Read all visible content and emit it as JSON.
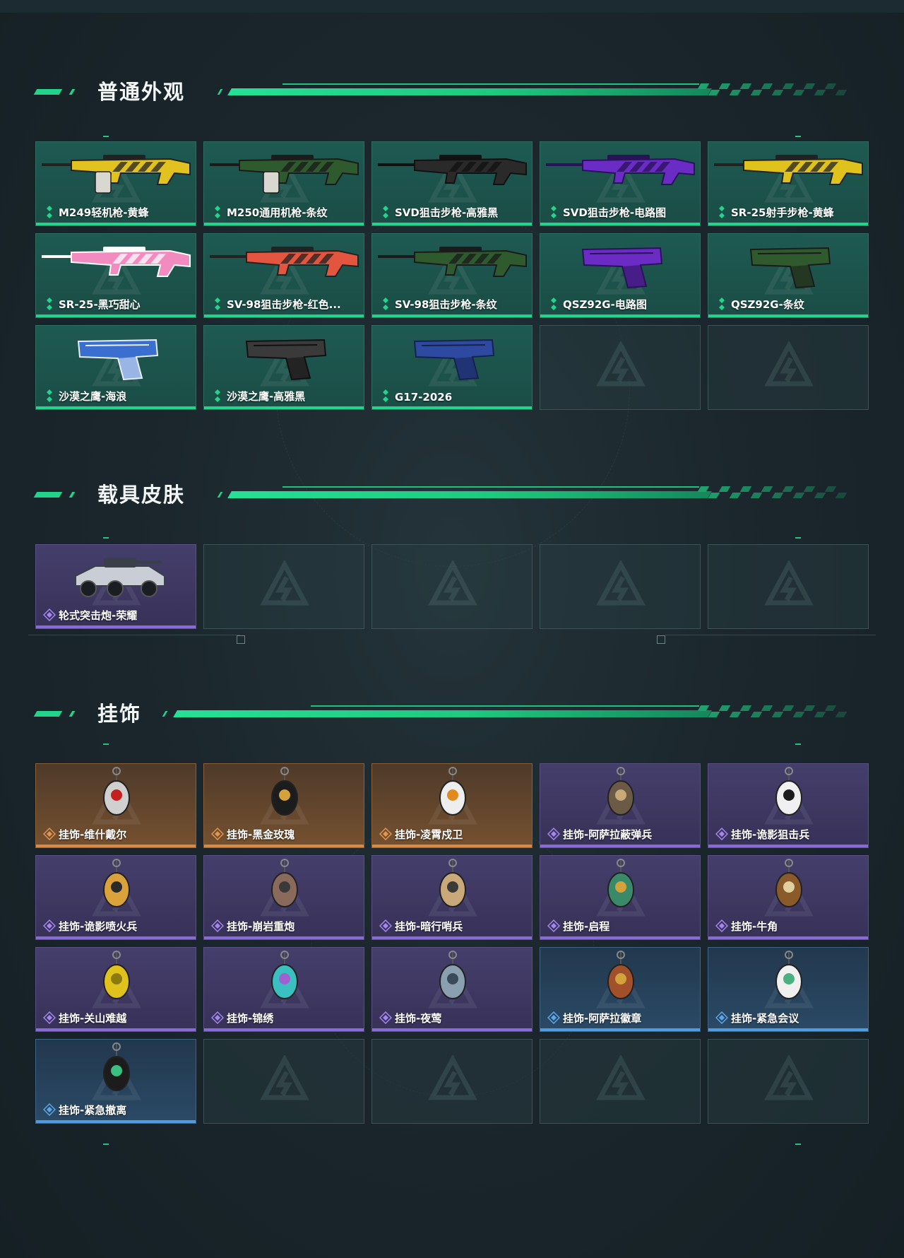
{
  "sections": {
    "normal": {
      "title": "普通外观",
      "items": [
        {
          "label": "M249轻机枪-黄蜂",
          "rarity": "green",
          "icon": "machine-gun-icon",
          "colors": [
            "#e2c21e",
            "#222222"
          ]
        },
        {
          "label": "M250通用机枪-条纹",
          "rarity": "green",
          "icon": "machine-gun-icon",
          "colors": [
            "#2f5a2e",
            "#1b1b1b"
          ]
        },
        {
          "label": "SVD狙击步枪-高雅黑",
          "rarity": "green",
          "icon": "sniper-rifle-icon",
          "colors": [
            "#2a2a2a",
            "#111111"
          ]
        },
        {
          "label": "SVD狙击步枪-电路图",
          "rarity": "green",
          "icon": "sniper-rifle-icon",
          "colors": [
            "#6a2cc4",
            "#2a1258"
          ]
        },
        {
          "label": "SR-25射手步枪-黄蜂",
          "rarity": "green",
          "icon": "rifle-icon",
          "colors": [
            "#e0c21c",
            "#222222"
          ]
        },
        {
          "label": "SR-25-黑巧甜心",
          "rarity": "green",
          "icon": "rifle-icon",
          "colors": [
            "#f28cc0",
            "#ffffff"
          ]
        },
        {
          "label": "SV-98狙击步枪-红色...",
          "rarity": "green",
          "icon": "sniper-rifle-icon",
          "colors": [
            "#e2553e",
            "#222222"
          ]
        },
        {
          "label": "SV-98狙击步枪-条纹",
          "rarity": "green",
          "icon": "sniper-rifle-icon",
          "colors": [
            "#2f5a2e",
            "#1b1b1b"
          ]
        },
        {
          "label": "QSZ92G-电路图",
          "rarity": "green",
          "icon": "pistol-icon",
          "colors": [
            "#6a2cc4",
            "#2a1258"
          ]
        },
        {
          "label": "QSZ92G-条纹",
          "rarity": "green",
          "icon": "pistol-icon",
          "colors": [
            "#2f5a2e",
            "#1b1b1b"
          ]
        },
        {
          "label": "沙漠之鹰-海浪",
          "rarity": "green",
          "icon": "pistol-icon",
          "colors": [
            "#3a6fd0",
            "#e8eef5"
          ]
        },
        {
          "label": "沙漠之鹰-高雅黑",
          "rarity": "green",
          "icon": "pistol-icon",
          "colors": [
            "#3a3a3a",
            "#111111"
          ]
        },
        {
          "label": "G17-2026",
          "rarity": "green",
          "icon": "pistol-icon",
          "colors": [
            "#2e4aa0",
            "#16224e"
          ]
        }
      ],
      "empty_slots": 2
    },
    "vehicle": {
      "title": "载具皮肤",
      "items": [
        {
          "label": "轮式突击炮-荣耀",
          "rarity": "purple",
          "icon": "armored-vehicle-icon",
          "colors": [
            "#c9ced6",
            "#3a3f48"
          ]
        }
      ],
      "empty_slots": 4
    },
    "charms": {
      "title": "挂饰",
      "items": [
        {
          "label": "挂饰-维什戴尔",
          "rarity": "orange",
          "icon": "charm-icon",
          "colors": [
            "#d0d0d0",
            "#c42020"
          ]
        },
        {
          "label": "挂饰-黑金玫瑰",
          "rarity": "orange",
          "icon": "charm-icon",
          "colors": [
            "#1c1c1c",
            "#d4a23a"
          ]
        },
        {
          "label": "挂饰-凌霄戍卫",
          "rarity": "orange",
          "icon": "charm-icon",
          "colors": [
            "#eeeeee",
            "#e08a20"
          ]
        },
        {
          "label": "挂饰-阿萨拉蔽弹兵",
          "rarity": "purple",
          "icon": "charm-icon",
          "colors": [
            "#6b5a45",
            "#c9a97a"
          ]
        },
        {
          "label": "挂饰-诡影狙击兵",
          "rarity": "purple",
          "icon": "charm-icon",
          "colors": [
            "#f0f0f0",
            "#1c1c1c"
          ]
        },
        {
          "label": "挂饰-诡影喷火兵",
          "rarity": "purple",
          "icon": "charm-icon",
          "colors": [
            "#d9a23a",
            "#2a2a2a"
          ]
        },
        {
          "label": "挂饰-崩岩重炮",
          "rarity": "purple",
          "icon": "charm-icon",
          "colors": [
            "#8a6a5a",
            "#3a3a3a"
          ]
        },
        {
          "label": "挂饰-暗行哨兵",
          "rarity": "purple",
          "icon": "charm-icon",
          "colors": [
            "#c9a97a",
            "#3a3a3a"
          ]
        },
        {
          "label": "挂饰-启程",
          "rarity": "purple",
          "icon": "charm-icon",
          "colors": [
            "#3a8a6a",
            "#d4a23a"
          ]
        },
        {
          "label": "挂饰-牛角",
          "rarity": "purple",
          "icon": "charm-icon",
          "colors": [
            "#8a5a2a",
            "#e0d0a0"
          ]
        },
        {
          "label": "挂饰-关山难越",
          "rarity": "purple",
          "icon": "charm-icon",
          "colors": [
            "#e0c21c",
            "#8a7a10"
          ]
        },
        {
          "label": "挂饰-锦绣",
          "rarity": "purple",
          "icon": "charm-icon",
          "colors": [
            "#3ac0c0",
            "#a060d0"
          ]
        },
        {
          "label": "挂饰-夜莺",
          "rarity": "purple",
          "icon": "charm-icon",
          "colors": [
            "#8aa0b0",
            "#3a4a5a"
          ]
        },
        {
          "label": "挂饰-阿萨拉徽章",
          "rarity": "blue",
          "icon": "charm-icon",
          "colors": [
            "#a0502a",
            "#d4a23a"
          ]
        },
        {
          "label": "挂饰-紧急会议",
          "rarity": "blue",
          "icon": "charm-icon",
          "colors": [
            "#f0f0f0",
            "#4ab080"
          ]
        },
        {
          "label": "挂饰-紧急撤离",
          "rarity": "blue",
          "icon": "charm-icon",
          "colors": [
            "#1c1c1c",
            "#3ac080"
          ]
        }
      ],
      "empty_slots": 4
    }
  },
  "accent": "#22d489"
}
